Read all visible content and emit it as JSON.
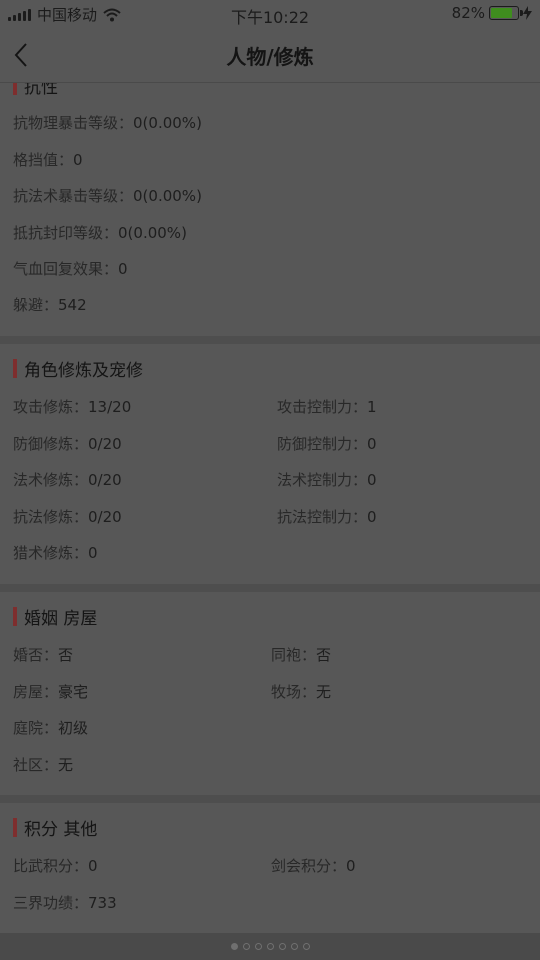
{
  "status_bar": {
    "carrier": "中国移动",
    "time": "下午10:22",
    "battery_percent": "82%",
    "battery_level": 0.82,
    "battery_color": "#3f8d1e"
  },
  "nav": {
    "title": "人物/修炼",
    "back_icon": "chevron-left-icon"
  },
  "sections": {
    "resistance": {
      "title": "抗性",
      "rows": [
        {
          "label": "抗物理暴击等级：",
          "value": "0(0.00%)"
        },
        {
          "label": "格挡值：",
          "value": "0"
        },
        {
          "label": "抗法术暴击等级：",
          "value": "0(0.00%)"
        },
        {
          "label": "抵抗封印等级：",
          "value": "0(0.00%)"
        },
        {
          "label": "气血回复效果：",
          "value": "0"
        },
        {
          "label": "躲避：",
          "value": "542"
        }
      ]
    },
    "cultivation": {
      "title": "角色修炼及宠修",
      "left": [
        {
          "label": "攻击修炼：",
          "value": "13/20"
        },
        {
          "label": "防御修炼：",
          "value": "0/20"
        },
        {
          "label": "法术修炼：",
          "value": "0/20"
        },
        {
          "label": "抗法修炼：",
          "value": "0/20"
        },
        {
          "label": "猎术修炼：",
          "value": "0"
        }
      ],
      "right": [
        {
          "label": "攻击控制力：",
          "value": "1"
        },
        {
          "label": "防御控制力：",
          "value": "0"
        },
        {
          "label": "法术控制力：",
          "value": "0"
        },
        {
          "label": "抗法控制力：",
          "value": "0"
        }
      ]
    },
    "marriage": {
      "title": "婚姻 房屋",
      "left": [
        {
          "label": "婚否：",
          "value": "否"
        },
        {
          "label": "房屋：",
          "value": "豪宅"
        },
        {
          "label": "庭院：",
          "value": "初级"
        },
        {
          "label": "社区：",
          "value": "无"
        }
      ],
      "right": [
        {
          "label": "同袍：",
          "value": "否"
        },
        {
          "label": "牧场：",
          "value": "无"
        }
      ]
    },
    "points": {
      "title": "积分 其他",
      "left": [
        {
          "label": "比武积分：",
          "value": "0"
        },
        {
          "label": "三界功绩：",
          "value": "733"
        }
      ],
      "right": [
        {
          "label": "剑会积分：",
          "value": "0"
        }
      ]
    }
  },
  "pager": {
    "count": 7,
    "active": 1
  }
}
